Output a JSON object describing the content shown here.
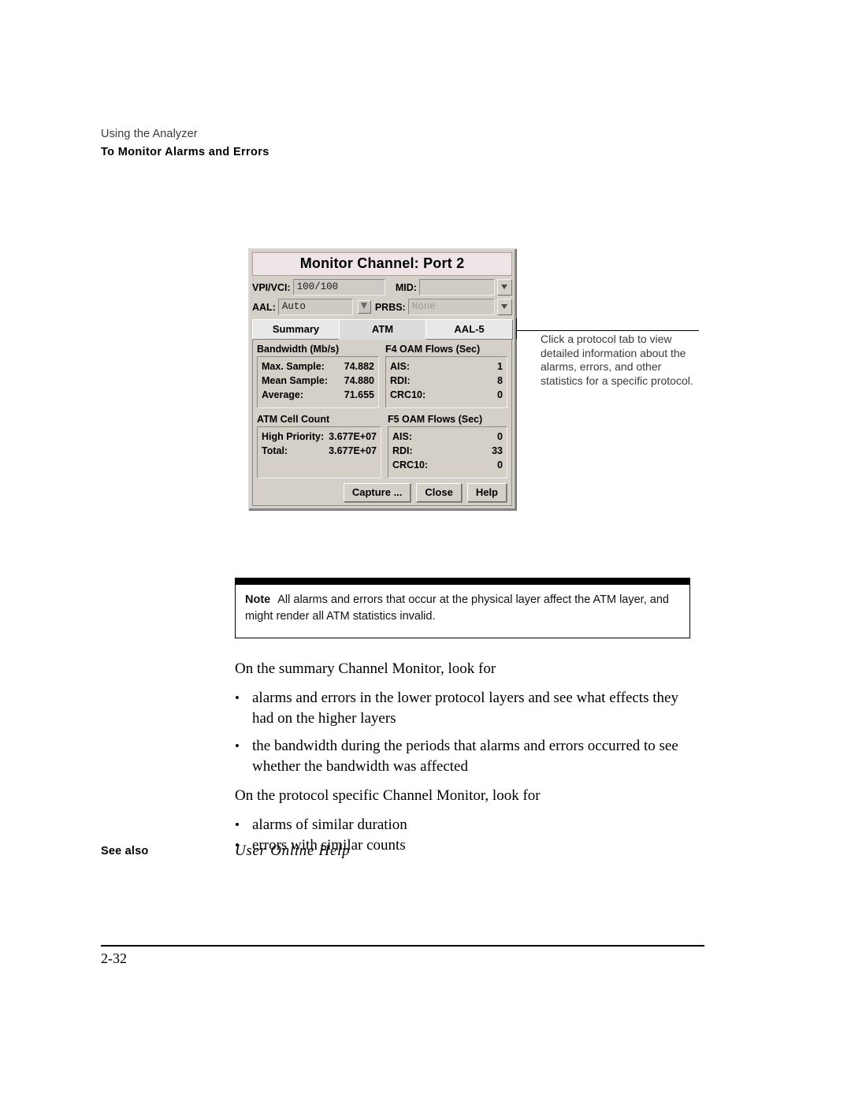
{
  "running_head": {
    "chapter": "Using the Analyzer",
    "section": "To Monitor Alarms and Errors"
  },
  "dialog": {
    "title": "Monitor Channel: Port 2",
    "fields": {
      "vpivci_label": "VPI/VCI:",
      "vpivci_value": "100/100",
      "mid_label": "MID:",
      "mid_value": "",
      "aal_label": "AAL:",
      "aal_value": "Auto",
      "prbs_label": "PRBS:",
      "prbs_value": "None"
    },
    "tabs": [
      {
        "label": "Summary"
      },
      {
        "label": "ATM"
      },
      {
        "label": "AAL-5"
      }
    ],
    "panels": {
      "bandwidth": {
        "title": "Bandwidth (Mb/s)",
        "rows": [
          {
            "key": "Max. Sample:",
            "value": "74.882"
          },
          {
            "key": "Mean Sample:",
            "value": "74.880"
          },
          {
            "key": "Average:",
            "value": "71.655"
          }
        ]
      },
      "f4_oam": {
        "title": "F4 OAM Flows (Sec)",
        "rows": [
          {
            "key": "AIS:",
            "value": "1"
          },
          {
            "key": "RDI:",
            "value": "8"
          },
          {
            "key": "CRC10:",
            "value": "0"
          }
        ]
      },
      "atm_cell_count": {
        "title": "ATM Cell Count",
        "rows": [
          {
            "key": "High Priority:",
            "value": "3.677E+07"
          },
          {
            "key": "Total:",
            "value": "3.677E+07"
          }
        ]
      },
      "f5_oam": {
        "title": "F5 OAM Flows (Sec)",
        "rows": [
          {
            "key": "AIS:",
            "value": "0"
          },
          {
            "key": "RDI:",
            "value": "33"
          },
          {
            "key": "CRC10:",
            "value": "0"
          }
        ]
      }
    },
    "buttons": {
      "capture": "Capture ...",
      "close": "Close",
      "help": "Help"
    }
  },
  "callout": {
    "text": "Click a protocol tab to view detailed information about the alarms, errors, and other statistics for a specific protocol."
  },
  "note": {
    "label": "Note",
    "text": "All alarms and errors that occur at the physical layer affect the ATM layer, and might render all ATM statistics invalid."
  },
  "body": {
    "intro_summary": "On the summary Channel Monitor, look for",
    "summary_bullets": [
      "alarms and errors in the lower protocol layers and see what effects they had on the higher layers",
      "the bandwidth during the periods that alarms and errors occurred to see whether the bandwidth was affected"
    ],
    "intro_protocol": "On the protocol specific Channel Monitor, look for",
    "protocol_bullets": [
      "alarms of similar duration",
      "errors with similar counts"
    ],
    "bullet_glyph": "•"
  },
  "see_also": {
    "label": "See also",
    "value": "User Online Help"
  },
  "footer": {
    "page_number": "2-32"
  }
}
